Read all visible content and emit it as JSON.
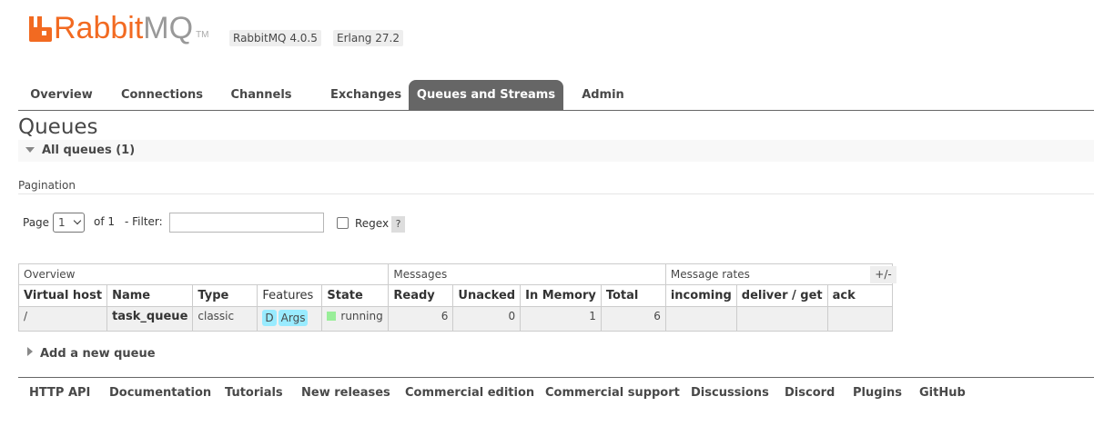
{
  "header": {
    "logo_primary": "Rabbit",
    "logo_secondary": "MQ",
    "logo_tm": "TM",
    "version": "RabbitMQ 4.0.5",
    "erlang": "Erlang 27.2",
    "brand_color": "#f26a21"
  },
  "tabs": [
    {
      "label": "Overview"
    },
    {
      "label": "Connections"
    },
    {
      "label": "Channels"
    },
    {
      "label": "Exchanges"
    },
    {
      "label": "Queues and Streams",
      "active": true
    },
    {
      "label": "Admin"
    }
  ],
  "page_title": "Queues",
  "all_queues": {
    "label": "All queues (1)"
  },
  "pagination": {
    "section_label": "Pagination",
    "page_label": "Page",
    "page_value": "1",
    "of_label": "of 1",
    "filter_label": "- Filter:",
    "filter_value": "",
    "regex_label": "Regex",
    "help": "?"
  },
  "table": {
    "groups": [
      "Overview",
      "Messages",
      "Message rates"
    ],
    "columns": [
      "Virtual host",
      "Name",
      "Type",
      "Features",
      "State",
      "Ready",
      "Unacked",
      "In Memory",
      "Total",
      "incoming",
      "deliver / get",
      "ack"
    ],
    "rows": [
      {
        "vhost": "/",
        "name": "task_queue",
        "type": "classic",
        "features": [
          "D",
          "Args"
        ],
        "state": "running",
        "ready": "6",
        "unacked": "0",
        "in_memory": "1",
        "total": "6",
        "incoming": "",
        "deliver_get": "",
        "ack": ""
      }
    ],
    "columns_toggle": "+/-"
  },
  "add_queue": {
    "label": "Add a new queue"
  },
  "footer_links": [
    "HTTP API",
    "Documentation",
    "Tutorials",
    "New releases",
    "Commercial edition",
    "Commercial support",
    "Discussions",
    "Discord",
    "Plugins",
    "GitHub"
  ]
}
